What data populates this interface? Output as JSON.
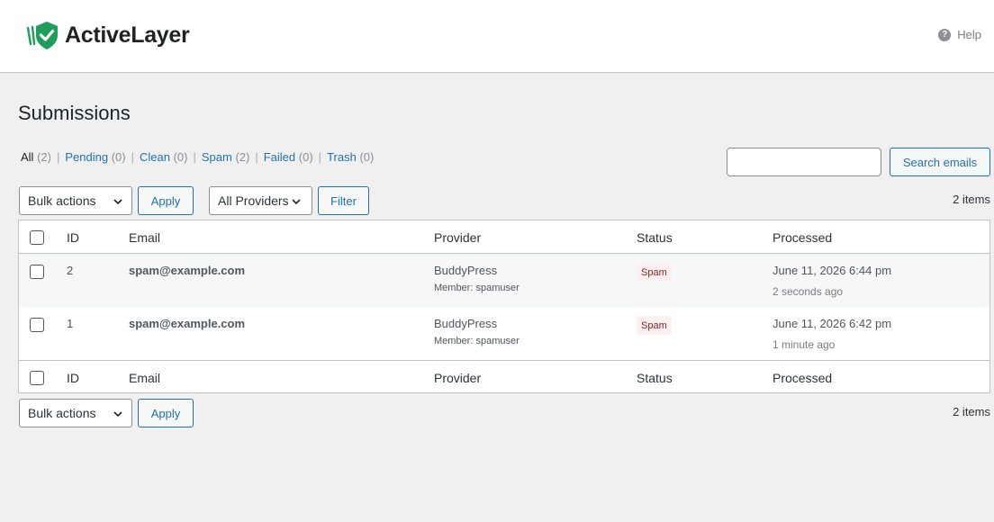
{
  "header": {
    "brand": "ActiveLayer",
    "help": "Help",
    "colors": {
      "brand_green": "#1e9e5a",
      "link_blue": "#2271b1"
    }
  },
  "page": {
    "title": "Submissions"
  },
  "filters": [
    {
      "label": "All",
      "count": "(2)"
    },
    {
      "label": "Pending",
      "count": "(0)"
    },
    {
      "label": "Clean",
      "count": "(0)"
    },
    {
      "label": "Spam",
      "count": "(2)"
    },
    {
      "label": "Failed",
      "count": "(0)"
    },
    {
      "label": "Trash",
      "count": "(0)"
    }
  ],
  "search": {
    "value": "",
    "placeholder": "",
    "button": "Search emails"
  },
  "toolbar_top": {
    "bulk_actions": "Bulk actions",
    "apply": "Apply",
    "providers": "All Providers",
    "filter": "Filter",
    "items": "2 items"
  },
  "table": {
    "columns": [
      "ID",
      "Email",
      "Provider",
      "Status",
      "Processed"
    ],
    "rows": [
      {
        "id": "2",
        "email": "spam@example.com",
        "provider": "BuddyPress",
        "member": "Member: spamuser",
        "status": "Spam",
        "date": "June 11, 2026 6:44 pm",
        "ago": "2 seconds ago"
      },
      {
        "id": "1",
        "email": "spam@example.com",
        "provider": "BuddyPress",
        "member": "Member: spamuser",
        "status": "Spam",
        "date": "June 11, 2026 6:42 pm",
        "ago": "1 minute ago"
      }
    ]
  },
  "toolbar_bottom": {
    "bulk_actions": "Bulk actions",
    "apply": "Apply",
    "items": "2 items"
  }
}
